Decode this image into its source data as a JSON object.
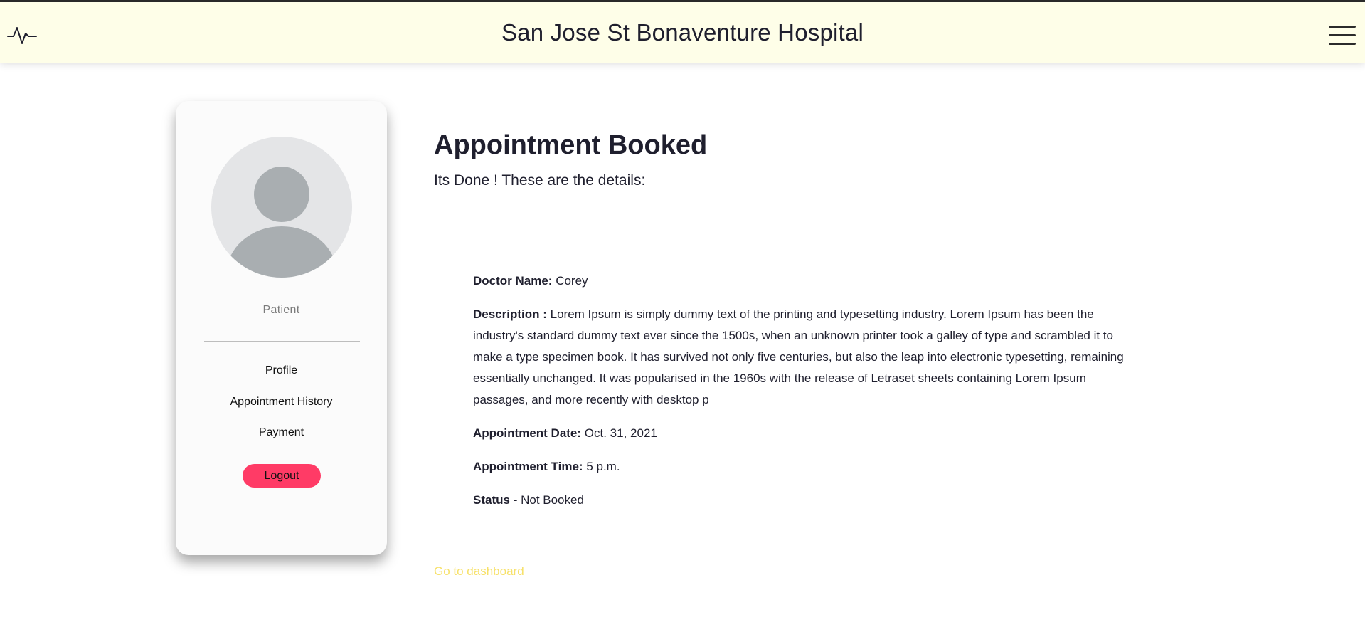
{
  "header": {
    "title": "San Jose St Bonaventure Hospital",
    "logo_icon": "heartbeat-pulse-icon",
    "menu_icon": "hamburger-menu-icon"
  },
  "sidebar": {
    "avatar_icon": "user-avatar-icon",
    "role": "Patient",
    "items": [
      {
        "label": "Profile"
      },
      {
        "label": "Appointment History"
      },
      {
        "label": "Payment"
      }
    ],
    "logout_label": "Logout",
    "logout_color": "#ff3b66"
  },
  "main": {
    "title": "Appointment Booked",
    "subtitle": "Its Done ! These are the details:",
    "details": {
      "doctor_label": "Doctor Name:",
      "doctor_value": "Corey",
      "description_label": "Description :",
      "description_value": "Lorem Ipsum is simply dummy text of the printing and typesetting industry. Lorem Ipsum has been the industry's standard dummy text ever since the 1500s, when an unknown printer took a galley of type and scrambled it to make a type specimen book. It has survived not only five centuries, but also the leap into electronic typesetting, remaining essentially unchanged. It was popularised in the 1960s with the release of Letraset sheets containing Lorem Ipsum passages, and more recently with desktop p",
      "date_label": "Appointment Date:",
      "date_value": "Oct. 31, 2021",
      "time_label": "Appointment Time:",
      "time_value": "5 p.m.",
      "status_label": "Status",
      "status_value": "- Not Booked"
    },
    "dashboard_link": "Go to dashboard"
  },
  "colors": {
    "header_bg": "#fefee8",
    "link": "#f7e16a",
    "logout": "#ff3b66"
  }
}
